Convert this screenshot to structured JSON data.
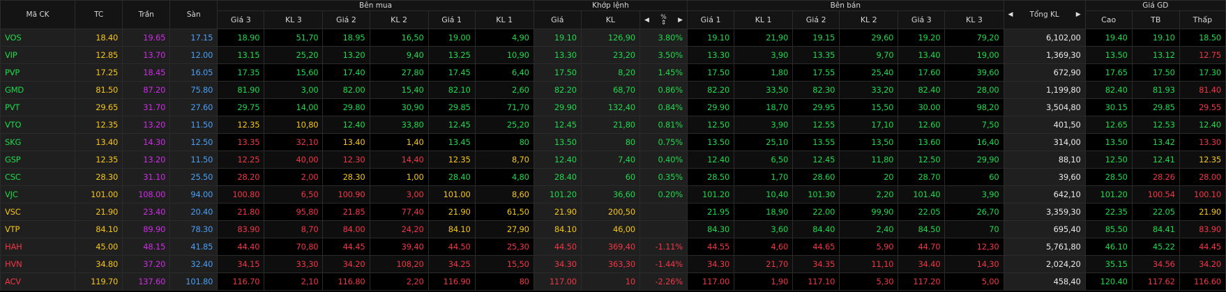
{
  "header": {
    "symbol": "Mã CK",
    "ref": "TC",
    "ceil": "Trần",
    "floor": "Sàn",
    "bid_group": "Bên mua",
    "match_group": "Khớp lệnh",
    "ask_group": "Bên bán",
    "total_vol": "Tổng KL",
    "trade_price_group": "Giá GD",
    "bid_cols": [
      "Giá 3",
      "KL 3",
      "Giá 2",
      "KL 2",
      "Giá 1",
      "KL 1"
    ],
    "match_cols": [
      "Giá",
      "KL",
      "%"
    ],
    "ask_cols": [
      "Giá 1",
      "KL 1",
      "Giá 2",
      "KL 2",
      "Giá 3",
      "KL 3"
    ],
    "trade_cols": [
      "Cao",
      "TB",
      "Thấp"
    ]
  },
  "icons": {
    "left_arrow": "caret-left-icon",
    "right_arrow": "caret-right-icon",
    "sort": "sort-icon"
  },
  "colors": {
    "up": "#1ed94b",
    "ref": "#f5c518",
    "ceil": "#d02be8",
    "floor": "#4a9ff5",
    "down": "#f23645",
    "white": "#e8e8e8"
  },
  "rows": [
    {
      "sym": "VOS",
      "sc": "up",
      "tc": "18.40",
      "tr": "19.65",
      "sa": "17.15",
      "b": [
        [
          "18.90",
          "up"
        ],
        [
          "51,70",
          "up"
        ],
        [
          "18.95",
          "up"
        ],
        [
          "16,50",
          "up"
        ],
        [
          "19.00",
          "up"
        ],
        [
          "4,90",
          "up"
        ]
      ],
      "m": [
        [
          "19.10",
          "up"
        ],
        [
          "126,90",
          "up"
        ],
        [
          "3.80%",
          "up"
        ]
      ],
      "a": [
        [
          "19.10",
          "up"
        ],
        [
          "21,90",
          "up"
        ],
        [
          "19.15",
          "up"
        ],
        [
          "29,60",
          "up"
        ],
        [
          "19.20",
          "up"
        ],
        [
          "79,20",
          "up"
        ]
      ],
      "tot": "6,102,00",
      "g": [
        [
          "19.40",
          "up"
        ],
        [
          "19.10",
          "up"
        ],
        [
          "18.50",
          "up"
        ]
      ]
    },
    {
      "sym": "VIP",
      "sc": "up",
      "tc": "12.85",
      "tr": "13.70",
      "sa": "12.00",
      "b": [
        [
          "13.15",
          "up"
        ],
        [
          "25,20",
          "up"
        ],
        [
          "13.20",
          "up"
        ],
        [
          "9,40",
          "up"
        ],
        [
          "13.25",
          "up"
        ],
        [
          "10,90",
          "up"
        ]
      ],
      "m": [
        [
          "13.30",
          "up"
        ],
        [
          "23,20",
          "up"
        ],
        [
          "3.50%",
          "up"
        ]
      ],
      "a": [
        [
          "13.30",
          "up"
        ],
        [
          "3,90",
          "up"
        ],
        [
          "13.35",
          "up"
        ],
        [
          "9,70",
          "up"
        ],
        [
          "13.40",
          "up"
        ],
        [
          "19,00",
          "up"
        ]
      ],
      "tot": "1,369,30",
      "g": [
        [
          "13.50",
          "up"
        ],
        [
          "13.12",
          "up"
        ],
        [
          "12.75",
          "down"
        ]
      ]
    },
    {
      "sym": "PVP",
      "sc": "up",
      "tc": "17.25",
      "tr": "18.45",
      "sa": "16.05",
      "b": [
        [
          "17.35",
          "up"
        ],
        [
          "15,60",
          "up"
        ],
        [
          "17.40",
          "up"
        ],
        [
          "27,80",
          "up"
        ],
        [
          "17.45",
          "up"
        ],
        [
          "6,40",
          "up"
        ]
      ],
      "m": [
        [
          "17.50",
          "up"
        ],
        [
          "8,20",
          "up"
        ],
        [
          "1.45%",
          "up"
        ]
      ],
      "a": [
        [
          "17.50",
          "up"
        ],
        [
          "1,80",
          "up"
        ],
        [
          "17.55",
          "up"
        ],
        [
          "25,40",
          "up"
        ],
        [
          "17.60",
          "up"
        ],
        [
          "39,60",
          "up"
        ]
      ],
      "tot": "672,90",
      "g": [
        [
          "17.65",
          "up"
        ],
        [
          "17.50",
          "up"
        ],
        [
          "17.30",
          "up"
        ]
      ]
    },
    {
      "sym": "GMD",
      "sc": "up",
      "tc": "81.50",
      "tr": "87.20",
      "sa": "75.80",
      "b": [
        [
          "81.90",
          "up"
        ],
        [
          "3,00",
          "up"
        ],
        [
          "82.00",
          "up"
        ],
        [
          "15,40",
          "up"
        ],
        [
          "82.10",
          "up"
        ],
        [
          "2,60",
          "up"
        ]
      ],
      "m": [
        [
          "82.20",
          "up"
        ],
        [
          "68,70",
          "up"
        ],
        [
          "0.86%",
          "up"
        ]
      ],
      "a": [
        [
          "82.20",
          "up"
        ],
        [
          "33,50",
          "up"
        ],
        [
          "82.30",
          "up"
        ],
        [
          "33,20",
          "up"
        ],
        [
          "82.40",
          "up"
        ],
        [
          "28,00",
          "up"
        ]
      ],
      "tot": "1,199,80",
      "g": [
        [
          "82.40",
          "up"
        ],
        [
          "81.93",
          "up"
        ],
        [
          "81.40",
          "down"
        ]
      ]
    },
    {
      "sym": "PVT",
      "sc": "up",
      "tc": "29.65",
      "tr": "31.70",
      "sa": "27.60",
      "b": [
        [
          "29.75",
          "up"
        ],
        [
          "14,00",
          "up"
        ],
        [
          "29.80",
          "up"
        ],
        [
          "30,90",
          "up"
        ],
        [
          "29.85",
          "up"
        ],
        [
          "71,70",
          "up"
        ]
      ],
      "m": [
        [
          "29.90",
          "up"
        ],
        [
          "132,40",
          "up"
        ],
        [
          "0.84%",
          "up"
        ]
      ],
      "a": [
        [
          "29.90",
          "up"
        ],
        [
          "18,70",
          "up"
        ],
        [
          "29.95",
          "up"
        ],
        [
          "15,50",
          "up"
        ],
        [
          "30.00",
          "up"
        ],
        [
          "98,20",
          "up"
        ]
      ],
      "tot": "3,504,80",
      "g": [
        [
          "30.15",
          "up"
        ],
        [
          "29.85",
          "up"
        ],
        [
          "29.55",
          "down"
        ]
      ]
    },
    {
      "sym": "VTO",
      "sc": "up",
      "tc": "12.35",
      "tr": "13.20",
      "sa": "11.50",
      "b": [
        [
          "12.35",
          "ref"
        ],
        [
          "10,80",
          "ref"
        ],
        [
          "12.40",
          "up"
        ],
        [
          "33,80",
          "up"
        ],
        [
          "12.45",
          "up"
        ],
        [
          "25,20",
          "up"
        ]
      ],
      "m": [
        [
          "12.45",
          "up"
        ],
        [
          "21,80",
          "up"
        ],
        [
          "0.81%",
          "up"
        ]
      ],
      "a": [
        [
          "12.50",
          "up"
        ],
        [
          "3,90",
          "up"
        ],
        [
          "12.55",
          "up"
        ],
        [
          "17,10",
          "up"
        ],
        [
          "12.60",
          "up"
        ],
        [
          "7,50",
          "up"
        ]
      ],
      "tot": "401,50",
      "g": [
        [
          "12.65",
          "up"
        ],
        [
          "12.53",
          "up"
        ],
        [
          "12.40",
          "up"
        ]
      ]
    },
    {
      "sym": "SKG",
      "sc": "up",
      "tc": "13.40",
      "tr": "14.30",
      "sa": "12.50",
      "b": [
        [
          "13.35",
          "down"
        ],
        [
          "32,10",
          "down"
        ],
        [
          "13.40",
          "ref"
        ],
        [
          "1,40",
          "ref"
        ],
        [
          "13.45",
          "up"
        ],
        [
          "80",
          "up"
        ]
      ],
      "m": [
        [
          "13.50",
          "up"
        ],
        [
          "80",
          "up"
        ],
        [
          "0.75%",
          "up"
        ]
      ],
      "a": [
        [
          "13.50",
          "up"
        ],
        [
          "25,10",
          "up"
        ],
        [
          "13.55",
          "up"
        ],
        [
          "13,50",
          "up"
        ],
        [
          "13.60",
          "up"
        ],
        [
          "16,40",
          "up"
        ]
      ],
      "tot": "314,00",
      "g": [
        [
          "13.50",
          "up"
        ],
        [
          "13.42",
          "up"
        ],
        [
          "13.30",
          "down"
        ]
      ]
    },
    {
      "sym": "GSP",
      "sc": "up",
      "tc": "12.35",
      "tr": "13.20",
      "sa": "11.50",
      "b": [
        [
          "12.25",
          "down"
        ],
        [
          "40,00",
          "down"
        ],
        [
          "12.30",
          "down"
        ],
        [
          "14,40",
          "down"
        ],
        [
          "12.35",
          "ref"
        ],
        [
          "8,70",
          "ref"
        ]
      ],
      "m": [
        [
          "12.40",
          "up"
        ],
        [
          "7,40",
          "up"
        ],
        [
          "0.40%",
          "up"
        ]
      ],
      "a": [
        [
          "12.40",
          "up"
        ],
        [
          "6,50",
          "up"
        ],
        [
          "12.45",
          "up"
        ],
        [
          "11,80",
          "up"
        ],
        [
          "12.50",
          "up"
        ],
        [
          "29,90",
          "up"
        ]
      ],
      "tot": "88,10",
      "g": [
        [
          "12.50",
          "up"
        ],
        [
          "12.41",
          "up"
        ],
        [
          "12.35",
          "ref"
        ]
      ]
    },
    {
      "sym": "CSC",
      "sc": "up",
      "tc": "28.30",
      "tr": "31.10",
      "sa": "25.50",
      "b": [
        [
          "28.20",
          "down"
        ],
        [
          "2,00",
          "down"
        ],
        [
          "28.30",
          "ref"
        ],
        [
          "1,00",
          "ref"
        ],
        [
          "28.40",
          "up"
        ],
        [
          "4,80",
          "up"
        ]
      ],
      "m": [
        [
          "28.40",
          "up"
        ],
        [
          "60",
          "up"
        ],
        [
          "0.35%",
          "up"
        ]
      ],
      "a": [
        [
          "28.50",
          "up"
        ],
        [
          "1,70",
          "up"
        ],
        [
          "28.60",
          "up"
        ],
        [
          "20",
          "up"
        ],
        [
          "28.70",
          "up"
        ],
        [
          "60",
          "up"
        ]
      ],
      "tot": "39,60",
      "g": [
        [
          "28.50",
          "up"
        ],
        [
          "28.26",
          "down"
        ],
        [
          "28.00",
          "down"
        ]
      ]
    },
    {
      "sym": "VJC",
      "sc": "up",
      "tc": "101.00",
      "tr": "108.00",
      "sa": "94.00",
      "b": [
        [
          "100.80",
          "down"
        ],
        [
          "6,50",
          "down"
        ],
        [
          "100.90",
          "down"
        ],
        [
          "3,00",
          "down"
        ],
        [
          "101.00",
          "ref"
        ],
        [
          "8,60",
          "ref"
        ]
      ],
      "m": [
        [
          "101.20",
          "up"
        ],
        [
          "36,60",
          "up"
        ],
        [
          "0.20%",
          "up"
        ]
      ],
      "a": [
        [
          "101.20",
          "up"
        ],
        [
          "10,40",
          "up"
        ],
        [
          "101.30",
          "up"
        ],
        [
          "2,20",
          "up"
        ],
        [
          "101.40",
          "up"
        ],
        [
          "3,90",
          "up"
        ]
      ],
      "tot": "642,10",
      "g": [
        [
          "101.20",
          "up"
        ],
        [
          "100.54",
          "down"
        ],
        [
          "100.10",
          "down"
        ]
      ]
    },
    {
      "sym": "VSC",
      "sc": "ref",
      "tc": "21.90",
      "tr": "23.40",
      "sa": "20.40",
      "b": [
        [
          "21.80",
          "down"
        ],
        [
          "95,80",
          "down"
        ],
        [
          "21.85",
          "down"
        ],
        [
          "77,40",
          "down"
        ],
        [
          "21.90",
          "ref"
        ],
        [
          "61,50",
          "ref"
        ]
      ],
      "m": [
        [
          "21.90",
          "ref"
        ],
        [
          "200,50",
          "ref"
        ],
        [
          "",
          ""
        ]
      ],
      "a": [
        [
          "21.95",
          "up"
        ],
        [
          "18,90",
          "up"
        ],
        [
          "22.00",
          "up"
        ],
        [
          "99,90",
          "up"
        ],
        [
          "22.05",
          "up"
        ],
        [
          "26,70",
          "up"
        ]
      ],
      "tot": "3,359,30",
      "g": [
        [
          "22.35",
          "up"
        ],
        [
          "22.05",
          "up"
        ],
        [
          "21.90",
          "ref"
        ]
      ]
    },
    {
      "sym": "VTP",
      "sc": "ref",
      "tc": "84.10",
      "tr": "89.90",
      "sa": "78.30",
      "b": [
        [
          "83.90",
          "down"
        ],
        [
          "8,70",
          "down"
        ],
        [
          "84.00",
          "down"
        ],
        [
          "24,20",
          "down"
        ],
        [
          "84.10",
          "ref"
        ],
        [
          "27,90",
          "ref"
        ]
      ],
      "m": [
        [
          "84.10",
          "ref"
        ],
        [
          "46,00",
          "ref"
        ],
        [
          "",
          ""
        ]
      ],
      "a": [
        [
          "84.30",
          "up"
        ],
        [
          "3,60",
          "up"
        ],
        [
          "84.40",
          "up"
        ],
        [
          "2,40",
          "up"
        ],
        [
          "84.50",
          "up"
        ],
        [
          "70",
          "up"
        ]
      ],
      "tot": "695,40",
      "g": [
        [
          "85.50",
          "up"
        ],
        [
          "84.41",
          "up"
        ],
        [
          "83.90",
          "down"
        ]
      ]
    },
    {
      "sym": "HAH",
      "sc": "down",
      "tc": "45.00",
      "tr": "48.15",
      "sa": "41.85",
      "b": [
        [
          "44.40",
          "down"
        ],
        [
          "70,80",
          "down"
        ],
        [
          "44.45",
          "down"
        ],
        [
          "39,40",
          "down"
        ],
        [
          "44.50",
          "down"
        ],
        [
          "25,30",
          "down"
        ]
      ],
      "m": [
        [
          "44.50",
          "down"
        ],
        [
          "369,40",
          "down"
        ],
        [
          "-1.11%",
          "down"
        ]
      ],
      "a": [
        [
          "44.55",
          "down"
        ],
        [
          "4,60",
          "down"
        ],
        [
          "44.65",
          "down"
        ],
        [
          "5,90",
          "down"
        ],
        [
          "44.70",
          "down"
        ],
        [
          "12,30",
          "down"
        ]
      ],
      "tot": "5,761,80",
      "g": [
        [
          "46.10",
          "up"
        ],
        [
          "45.22",
          "up"
        ],
        [
          "44.45",
          "down"
        ]
      ]
    },
    {
      "sym": "HVN",
      "sc": "down",
      "tc": "34.80",
      "tr": "37.20",
      "sa": "32.40",
      "b": [
        [
          "34.15",
          "down"
        ],
        [
          "33,30",
          "down"
        ],
        [
          "34.20",
          "down"
        ],
        [
          "108,20",
          "down"
        ],
        [
          "34.25",
          "down"
        ],
        [
          "15,50",
          "down"
        ]
      ],
      "m": [
        [
          "34.30",
          "down"
        ],
        [
          "363,30",
          "down"
        ],
        [
          "-1.44%",
          "down"
        ]
      ],
      "a": [
        [
          "34.30",
          "down"
        ],
        [
          "21,70",
          "down"
        ],
        [
          "34.35",
          "down"
        ],
        [
          "11,10",
          "down"
        ],
        [
          "34.40",
          "down"
        ],
        [
          "14,30",
          "down"
        ]
      ],
      "tot": "2,024,20",
      "g": [
        [
          "35.15",
          "up"
        ],
        [
          "34.56",
          "down"
        ],
        [
          "34.20",
          "down"
        ]
      ]
    },
    {
      "sym": "ACV",
      "sc": "down",
      "tc": "119.70",
      "tr": "137.60",
      "sa": "101.80",
      "b": [
        [
          "116.70",
          "down"
        ],
        [
          "2,10",
          "down"
        ],
        [
          "116.80",
          "down"
        ],
        [
          "2,20",
          "down"
        ],
        [
          "116.90",
          "down"
        ],
        [
          "80",
          "down"
        ]
      ],
      "m": [
        [
          "117.00",
          "down"
        ],
        [
          "10",
          "down"
        ],
        [
          "-2.26%",
          "down"
        ]
      ],
      "a": [
        [
          "117.00",
          "down"
        ],
        [
          "1,90",
          "down"
        ],
        [
          "117.10",
          "down"
        ],
        [
          "5,30",
          "down"
        ],
        [
          "117.20",
          "down"
        ],
        [
          "5,00",
          "down"
        ]
      ],
      "tot": "458,40",
      "g": [
        [
          "120.40",
          "up"
        ],
        [
          "117.62",
          "down"
        ],
        [
          "116.60",
          "down"
        ]
      ]
    }
  ]
}
